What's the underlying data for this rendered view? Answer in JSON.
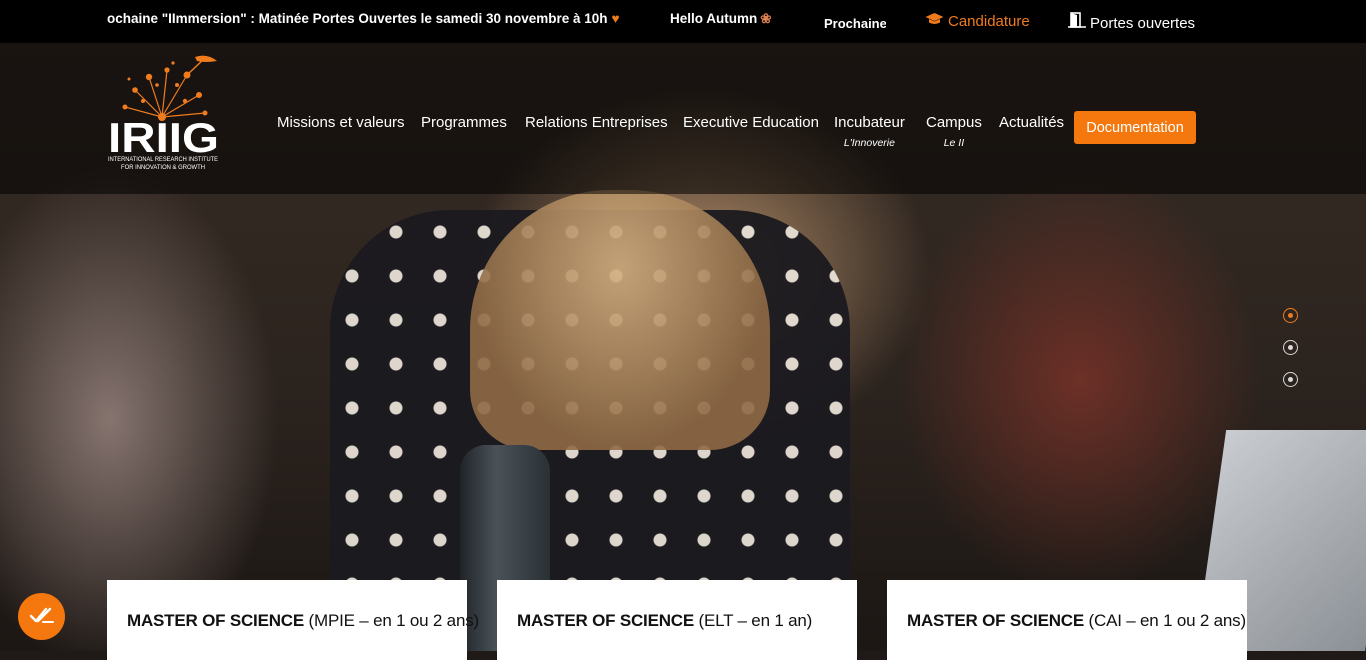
{
  "topbar": {
    "ticker_prefix": "ochaine \"",
    "ticker_event": "IImmersion",
    "ticker_middle": "\" : Matinée Portes Ouvertes le samedi 30 novembre à ",
    "ticker_time": "10h",
    "heart_icon": "orange-heart-icon",
    "autumn": "Hello Autumn",
    "leaf_icon": "autumn-leaves-icon",
    "prochaine": "Prochaine",
    "candidature": "Candidature",
    "candidature_icon": "graduation-cap-icon",
    "portes_ouvertes": "Portes ouvertes",
    "portes_icon": "door-icon",
    "accent": "#f07c1e"
  },
  "logo": {
    "wordmark": "IRIIG",
    "tagline_1": "INTERNATIONAL RESEARCH INSTITUTE",
    "tagline_2": "FOR INNOVATION & GROWTH"
  },
  "nav": {
    "items": [
      {
        "label": "Missions et valeurs"
      },
      {
        "label": "Programmes"
      },
      {
        "label": "Relations Entreprises"
      },
      {
        "label": "Executive Education"
      },
      {
        "label": "Incubateur",
        "sub": "L'Innoverie"
      },
      {
        "label": "Campus",
        "sub": "Le II"
      },
      {
        "label": "Actualités"
      }
    ],
    "cta": "Documentation",
    "cta_color": "#f4780e"
  },
  "slider": {
    "active_index": 0,
    "count": 3
  },
  "cards": [
    {
      "title": "MASTER OF SCIENCE",
      "detail": " (MPIE – en 1 ou 2 ans)"
    },
    {
      "title": "MASTER OF SCIENCE",
      "detail": " (ELT – en 1 an)"
    },
    {
      "title": "MASTER OF SCIENCE",
      "detail": " (CAI – en 1 ou 2 ans)"
    }
  ],
  "accessibility": {
    "icon": "accessibility-check-icon"
  }
}
